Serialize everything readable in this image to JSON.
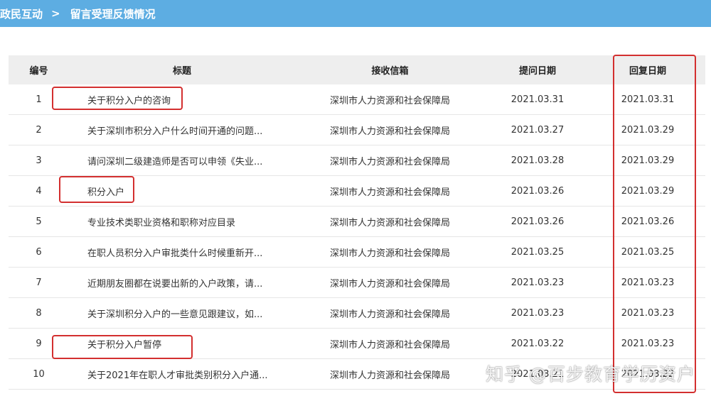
{
  "breadcrumb": {
    "home": "政民互动",
    "separator": ">",
    "current": "留言受理反馈情况"
  },
  "table": {
    "headers": {
      "no": "编号",
      "title": "标题",
      "inbox": "接收信箱",
      "ask_date": "提问日期",
      "reply_date": "回复日期"
    },
    "rows": [
      {
        "no": "1",
        "title": "关于积分入户的咨询",
        "inbox": "深圳市人力资源和社会保障局",
        "ask_date": "2021.03.31",
        "reply_date": "2021.03.31"
      },
      {
        "no": "2",
        "title": "关于深圳市积分入户什么时间开通的问题...",
        "inbox": "深圳市人力资源和社会保障局",
        "ask_date": "2021.03.27",
        "reply_date": "2021.03.29"
      },
      {
        "no": "3",
        "title": "请问深圳二级建造师是否可以申领《失业...",
        "inbox": "深圳市人力资源和社会保障局",
        "ask_date": "2021.03.28",
        "reply_date": "2021.03.29"
      },
      {
        "no": "4",
        "title": "积分入户",
        "inbox": "深圳市人力资源和社会保障局",
        "ask_date": "2021.03.26",
        "reply_date": "2021.03.29"
      },
      {
        "no": "5",
        "title": "专业技术类职业资格和职称对应目录",
        "inbox": "深圳市人力资源和社会保障局",
        "ask_date": "2021.03.26",
        "reply_date": "2021.03.26"
      },
      {
        "no": "6",
        "title": "在职人员积分入户审批类什么时候重新开...",
        "inbox": "深圳市人力资源和社会保障局",
        "ask_date": "2021.03.25",
        "reply_date": "2021.03.25"
      },
      {
        "no": "7",
        "title": "近期朋友圈都在说要出新的入户政策，请...",
        "inbox": "深圳市人力资源和社会保障局",
        "ask_date": "2021.03.23",
        "reply_date": "2021.03.23"
      },
      {
        "no": "8",
        "title": "关于深圳积分入户的一些意见跟建议，如...",
        "inbox": "深圳市人力资源和社会保障局",
        "ask_date": "2021.03.23",
        "reply_date": "2021.03.23"
      },
      {
        "no": "9",
        "title": "关于积分入户暂停",
        "inbox": "深圳市人力资源和社会保障局",
        "ask_date": "2021.03.22",
        "reply_date": "2021.03.23"
      },
      {
        "no": "10",
        "title": "关于2021年在职人才审批类别积分入户通...",
        "inbox": "深圳市人力资源和社会保障局",
        "ask_date": "2021.03.21",
        "reply_date": "2021.03.22"
      }
    ]
  },
  "watermark": "知乎 @百步教育学历资户",
  "colors": {
    "topbar": "#5dade2",
    "header_bg": "#eeeeee",
    "highlight": "#d32f2f"
  }
}
